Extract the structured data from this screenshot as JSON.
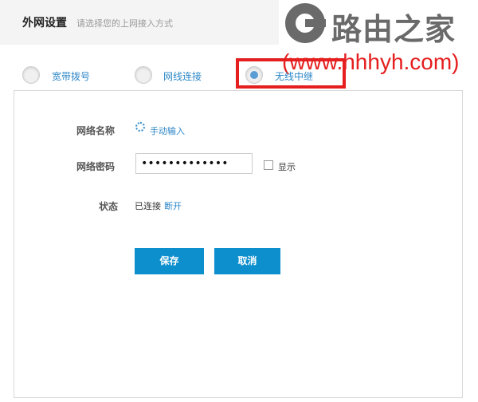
{
  "header": {
    "title": "外网设置",
    "subtitle": "请选择您的上网接入方式"
  },
  "watermark": {
    "name": "路由之家",
    "url": "(www.hhhyh.com)"
  },
  "connection_types": {
    "pppoe": "宽带拨号",
    "wired": "网线连接",
    "wireless": "无线中继",
    "selected": "无线中继"
  },
  "form": {
    "network_name_label": "网络名称",
    "manual_input_link": "手动输入",
    "password_label": "网络密码",
    "password_value": "•••••••••••••",
    "show_label": "显示",
    "status_label": "状态",
    "status_value": "已连接",
    "disconnect_link": "断开"
  },
  "buttons": {
    "save": "保存",
    "cancel": "取消"
  },
  "colors": {
    "accent": "#0e8fcd",
    "link": "#2d87c8",
    "highlight": "#e51f1f"
  }
}
